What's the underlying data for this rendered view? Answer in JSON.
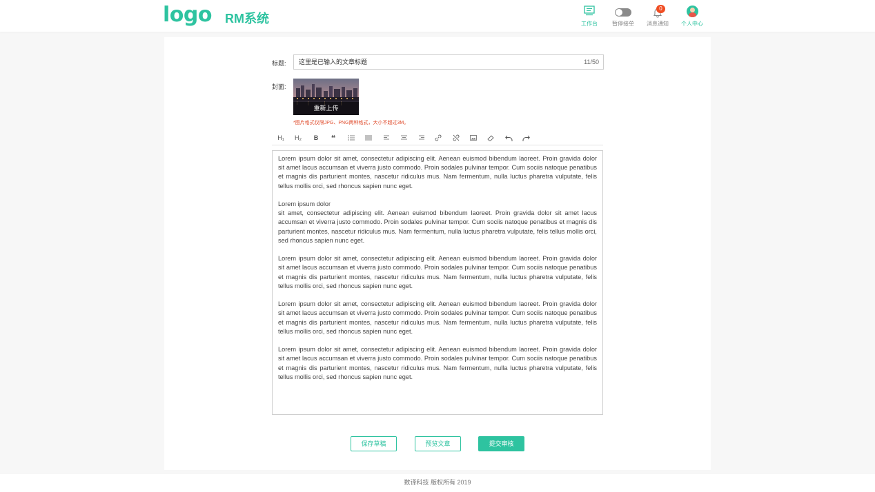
{
  "header": {
    "logo": "logo",
    "system_name": "RM系统",
    "nav": [
      {
        "label": "工作台",
        "icon": "monitor-icon",
        "active": true
      },
      {
        "label": "暂停接单",
        "icon": "toggle-icon"
      },
      {
        "label": "消息通知",
        "icon": "bell-icon",
        "badge": "0"
      },
      {
        "label": "个人中心",
        "icon": "avatar-icon",
        "active": true
      }
    ]
  },
  "form": {
    "title_label": "标题:",
    "title_value": "这里是已输入的文章标题",
    "title_count": "11/50",
    "cover_label": "封面:",
    "cover_upload_label": "重新上传",
    "cover_hint": "*图片格式仅限JPG、PNG两种格式，大小不超过3M。"
  },
  "toolbar": {
    "h1": "H₁",
    "h2": "H₂",
    "bold": "B",
    "quote": "❝",
    "icons": [
      "h1-icon",
      "h2-icon",
      "bold-icon",
      "quote-icon",
      "ordered-list-icon",
      "unordered-list-icon",
      "align-left-icon",
      "align-center-icon",
      "align-right-icon",
      "link-icon",
      "unlink-icon",
      "image-icon",
      "eraser-icon",
      "undo-icon",
      "redo-icon"
    ]
  },
  "editor": {
    "paragraphs": [
      "Lorem ipsum dolor sit amet, consectetur adipiscing elit. Aenean euismod bibendum laoreet. Proin gravida dolor sit amet lacus accumsan et viverra justo commodo. Proin sodales pulvinar tempor. Cum sociis natoque penatibus et magnis dis parturient montes, nascetur ridiculus mus. Nam fermentum, nulla luctus pharetra vulputate, felis tellus mollis orci, sed rhoncus sapien nunc eget.",
      "Lorem ipsum dolor",
      "sit amet, consectetur adipiscing elit. Aenean euismod bibendum laoreet. Proin gravida dolor sit amet lacus accumsan et viverra justo commodo. Proin sodales pulvinar tempor. Cum sociis natoque penatibus et magnis dis parturient montes, nascetur ridiculus mus. Nam fermentum, nulla luctus pharetra vulputate, felis tellus mollis orci, sed rhoncus sapien nunc eget.",
      "Lorem ipsum dolor sit amet, consectetur adipiscing elit. Aenean euismod bibendum laoreet. Proin gravida dolor sit amet lacus accumsan et viverra justo commodo. Proin sodales pulvinar tempor. Cum sociis natoque penatibus et magnis dis parturient montes, nascetur ridiculus mus. Nam fermentum, nulla luctus pharetra vulputate, felis tellus mollis orci, sed rhoncus sapien nunc eget.",
      "Lorem ipsum dolor sit amet, consectetur adipiscing elit. Aenean euismod bibendum laoreet. Proin gravida dolor sit amet lacus accumsan et viverra justo commodo. Proin sodales pulvinar tempor. Cum sociis natoque penatibus et magnis dis parturient montes, nascetur ridiculus mus. Nam fermentum, nulla luctus pharetra vulputate, felis tellus mollis orci, sed rhoncus sapien nunc eget.",
      "Lorem ipsum dolor sit amet, consectetur adipiscing elit. Aenean euismod bibendum laoreet. Proin gravida dolor sit amet lacus accumsan et viverra justo commodo. Proin sodales pulvinar tempor. Cum sociis natoque penatibus et magnis dis parturient montes, nascetur ridiculus mus. Nam fermentum, nulla luctus pharetra vulputate, felis tellus mollis orci, sed rhoncus sapien nunc eget."
    ]
  },
  "actions": {
    "save_draft": "保存草稿",
    "preview": "预览文章",
    "submit": "提交审核"
  },
  "footer": {
    "copyright": "数译科技 版权所有 2019"
  },
  "colors": {
    "accent": "#2ec3a0",
    "hint": "#e04b2b",
    "badge": "#f04d23"
  }
}
